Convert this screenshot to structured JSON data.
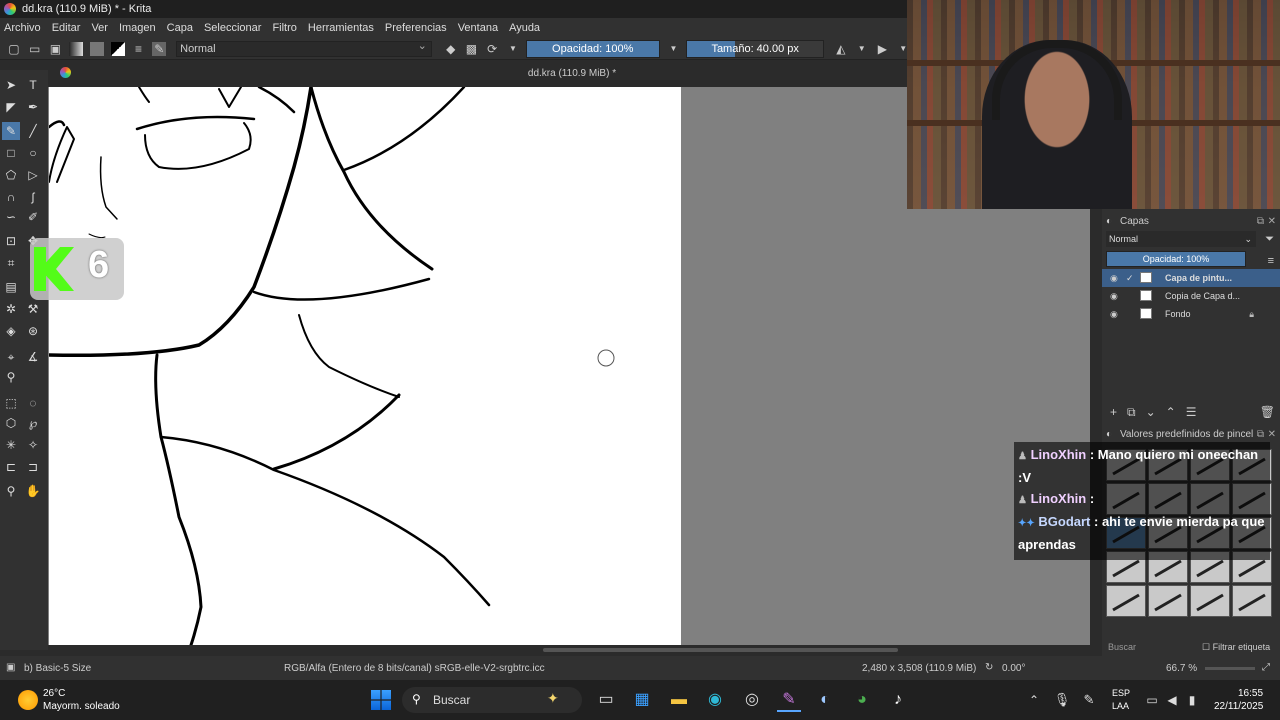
{
  "window": {
    "title": "dd.kra (110.9 MiB) * - Krita"
  },
  "menu": [
    "Archivo",
    "Editar",
    "Ver",
    "Imagen",
    "Capa",
    "Seleccionar",
    "Filtro",
    "Herramientas",
    "Preferencias",
    "Ventana",
    "Ayuda"
  ],
  "toolbar": {
    "blend_mode": "Normal",
    "opacity_label": "Opacidad: 100%",
    "opacity_value": 1.0,
    "size_label": "Tamaño: 40.00 px",
    "size_fraction": 0.35
  },
  "document": {
    "tab_title": "dd.kra (110.9 MiB) *"
  },
  "overlay_badge": {
    "text": "6"
  },
  "layers_docker": {
    "title": "Capas",
    "blend_mode": "Normal",
    "opacity_label": "Opacidad:  100%",
    "layers": [
      {
        "name": "Capa de pintu...",
        "selected": true
      },
      {
        "name": "Copia de Capa d...",
        "selected": false
      },
      {
        "name": "Fondo",
        "selected": false
      }
    ]
  },
  "brush_docker": {
    "title": "Valores predefinidos de pincel",
    "search_placeholder": "Buscar",
    "filter_label": "Filtrar etiqueta"
  },
  "chat": [
    {
      "user": "LinoXhin",
      "message": ": Mano quiero mi oneechan :V"
    },
    {
      "user": "LinoXhin",
      "message": ":"
    },
    {
      "user": "BGodart",
      "message": ": ahi te envie mierda pa que aprendas"
    }
  ],
  "statusbar": {
    "brush_preset": "b) Basic-5 Size",
    "color_info": "RGB/Alfa (Entero de 8 bits/canal)  sRGB-elle-V2-srgbtrc.icc",
    "dimensions": "2,480 x 3,508 (110.9 MiB)",
    "rotation": "0.00°",
    "zoom": "66.7 %"
  },
  "taskbar": {
    "weather_temp": "26°C",
    "weather_desc": "Mayorm. soleado",
    "search_label": "Buscar",
    "lang_top": "ESP",
    "lang_bottom": "LAA",
    "time": "16:55",
    "date": "22/11/2025"
  },
  "colors": {
    "accent": "#4a78a8",
    "selected_layer": "#3b5f8a",
    "panel": "#313131"
  }
}
